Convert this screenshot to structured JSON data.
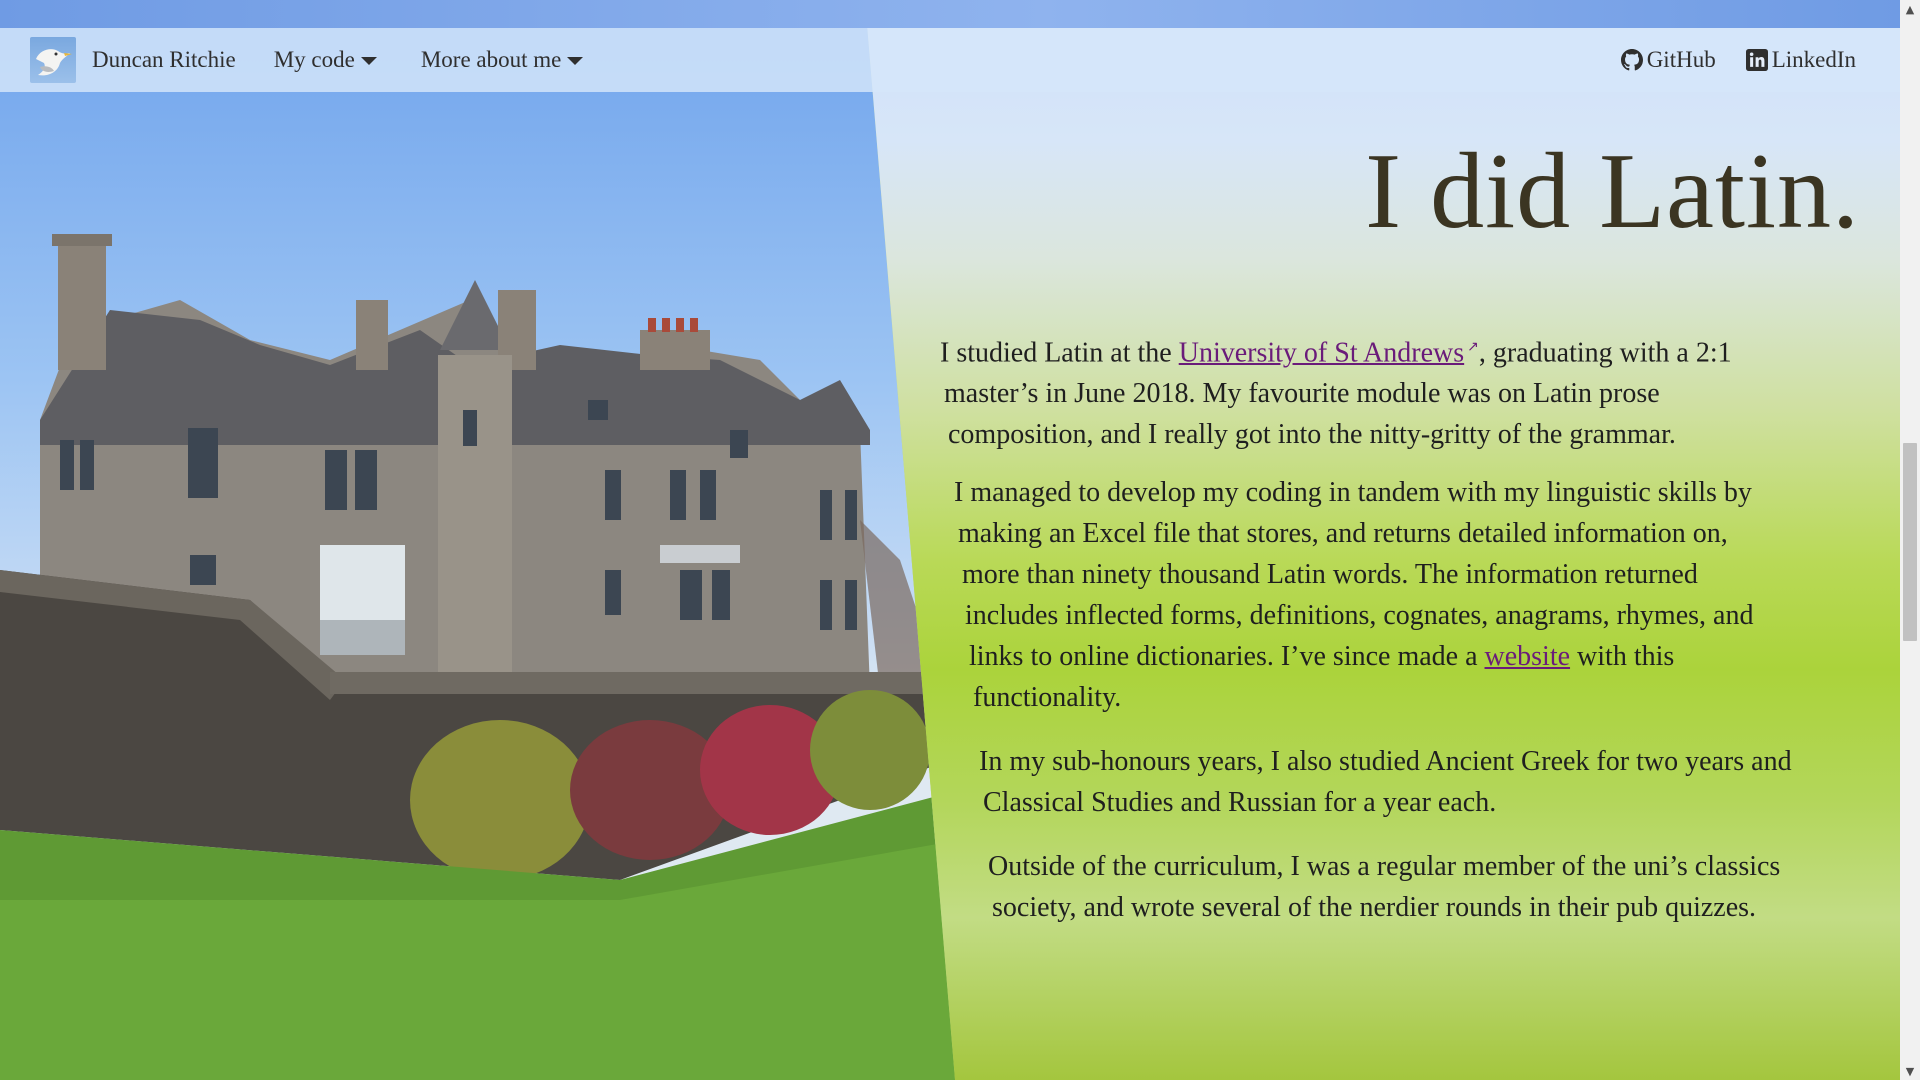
{
  "navbar": {
    "brand_name": "Duncan Ritchie",
    "menus": [
      {
        "label": "My code",
        "icon": "caret-down-icon"
      },
      {
        "label": "More about me",
        "icon": "caret-down-icon"
      }
    ],
    "links": [
      {
        "label": "GitHub",
        "icon": "github-icon"
      },
      {
        "label": "LinkedIn",
        "icon": "linkedin-icon"
      }
    ]
  },
  "page": {
    "title": "I did Latin.",
    "p1": {
      "before_link": "I studied Latin at the ",
      "link_text": "University of St Andrews",
      "ext_icon": "↗",
      "after_link": ", graduating with a 2:1",
      "line2": "master’s in June 2018. My favourite module was on Latin prose",
      "line3": "composition, and I really got into the nitty-gritty of the grammar."
    },
    "p2": {
      "line1": "I managed to develop my coding in tandem with my linguistic skills by",
      "line2": "making an Excel file that stores, and returns detailed information on,",
      "line3": "more than ninety thousand Latin words. The information returned",
      "line4": "includes inflected forms, definitions, cognates, anagrams, rhymes, and",
      "line5_before": "links to online dictionaries. I’ve since made a ",
      "line5_link": "website",
      "line5_after": " with this",
      "line6": "functionality."
    },
    "p3": {
      "line1": "In my sub-honours years, I also studied Ancient Greek for two years and",
      "line2": "Classical Studies and Russian for a year each."
    },
    "p4": {
      "line1": "Outside of the curriculum, I was a regular member of the uni’s classics",
      "line2": "society, and wrote several of the nerdier rounds in their pub quizzes."
    }
  },
  "scrollbar": {
    "up_icon": "▲",
    "down_icon": "▼"
  },
  "colors": {
    "link": "#6a1b7a",
    "title": "#3b3522",
    "navbar": "#d6e6fa"
  }
}
